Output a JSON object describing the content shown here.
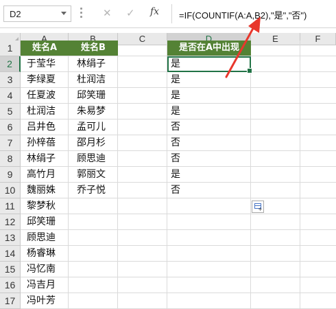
{
  "formula_bar": {
    "name_box": "D2",
    "cancel_icon": "✕",
    "enter_icon": "✓",
    "fx_label": "fx",
    "formula": "=IF(COUNTIF(A:A,B2),\"是\",\"否\")"
  },
  "columns": [
    "A",
    "B",
    "C",
    "D",
    "E",
    "F"
  ],
  "rows": [
    "1",
    "2",
    "3",
    "4",
    "5",
    "6",
    "7",
    "8",
    "9",
    "10",
    "11",
    "12",
    "13",
    "14",
    "15",
    "16",
    "17"
  ],
  "headers": {
    "a": "姓名A",
    "b": "姓名B",
    "d": "是否在A中出现"
  },
  "column_a": [
    "于莹华",
    "李绿夏",
    "任夏波",
    "杜润洁",
    "吕井色",
    "孙梓蓓",
    "林绢子",
    "高竹月",
    "魏丽姝",
    "黎梦秋",
    "邱笑珊",
    "顾思迪",
    "杨睿琳",
    "冯忆南",
    "冯吉月",
    "冯叶芳"
  ],
  "column_b": [
    "林绢子",
    "杜润洁",
    "邱笑珊",
    "朱易梦",
    "孟可儿",
    "邵月杉",
    "顾思迪",
    "郭丽文",
    "乔子悦"
  ],
  "column_d": [
    "是",
    "是",
    "是",
    "是",
    "否",
    "否",
    "否",
    "是",
    "否"
  ],
  "colors": {
    "header_fill": "#548235",
    "selection": "#217346",
    "annotation_arrow": "#e8372c"
  },
  "icons": {
    "name_box_dropdown": "chevron-down-icon",
    "autofill_options": "paste-options-icon",
    "annotation": "red-arrow-icon"
  }
}
